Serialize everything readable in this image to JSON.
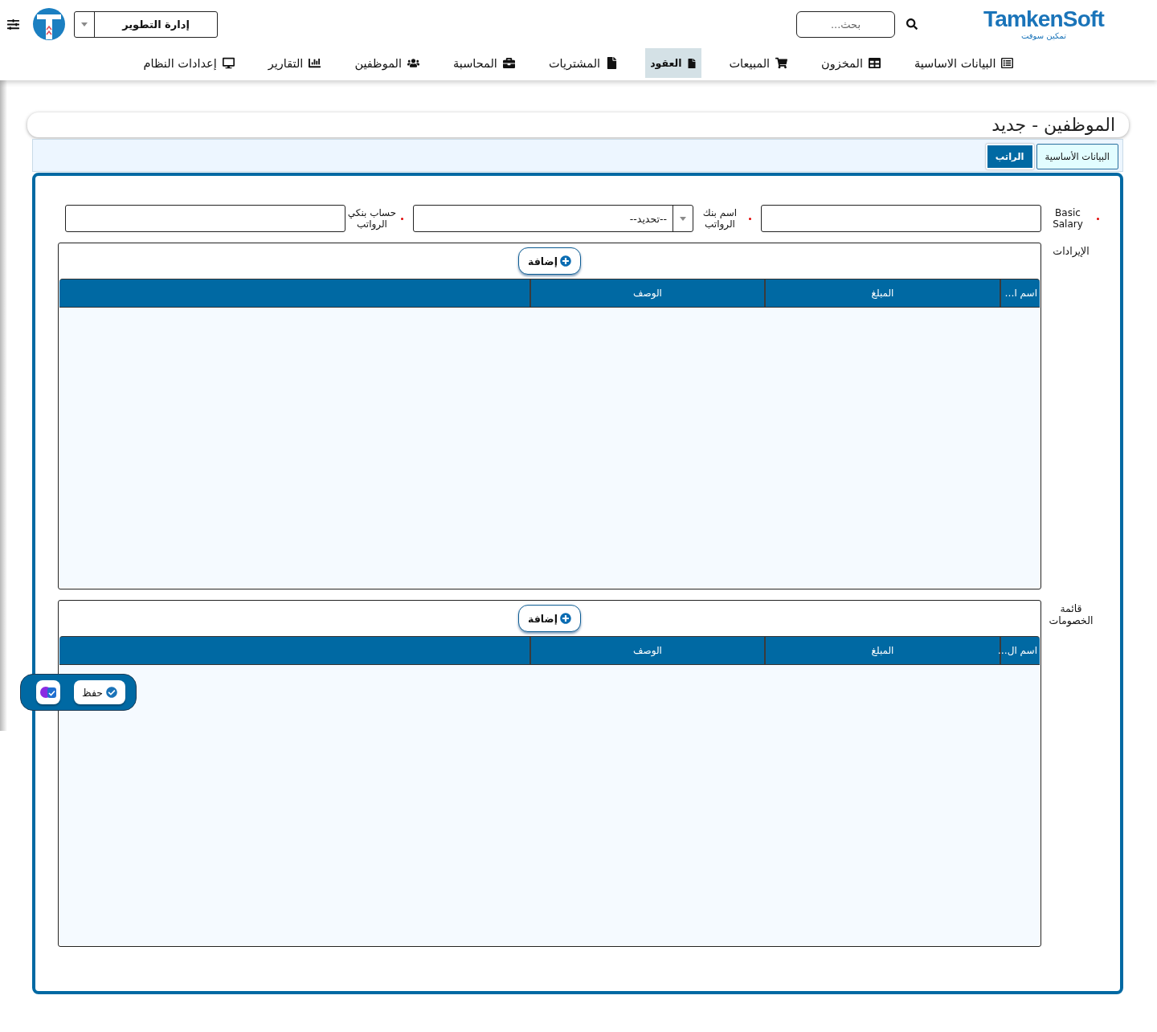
{
  "header": {
    "logo": {
      "wordmark": "TamkenSoft",
      "tagline": "تمكين سوفت"
    },
    "search": {
      "placeholder": "بحث..."
    },
    "department_select": {
      "value": "إدارة التطوير"
    }
  },
  "nav": [
    {
      "label": "البيانات الاساسية",
      "selected": false
    },
    {
      "label": "المخزون",
      "selected": false
    },
    {
      "label": "المبيعات",
      "selected": false
    },
    {
      "label": "العقود",
      "selected": true
    },
    {
      "label": "المشتريات",
      "selected": false
    },
    {
      "label": "المحاسبة",
      "selected": false
    },
    {
      "label": "الموظفين",
      "selected": false
    },
    {
      "label": "التقارير",
      "selected": false
    },
    {
      "label": "إعدادات النظام",
      "selected": false
    }
  ],
  "page_title": "الموظفين - جديد",
  "tabs": [
    {
      "label": "البيانات الأساسية",
      "selected": false
    },
    {
      "label": "الراتب",
      "selected": true
    }
  ],
  "form": {
    "fields": [
      {
        "kind": "input",
        "label": "Basic Salary",
        "required": true
      },
      {
        "kind": "select",
        "label": "اسم بنك الرواتب",
        "required": true,
        "value": "--تحديد--"
      },
      {
        "kind": "input",
        "label": "حساب بنكي الرواتب",
        "required": true
      }
    ]
  },
  "sections": [
    {
      "label": "الإيرادات",
      "add_button": "إضافة",
      "table": {
        "columns": [
          "اسم ا…",
          "المبلغ",
          "الوصف"
        ]
      }
    },
    {
      "label": "قائمة الخصومات",
      "add_button": "إضافة",
      "table": {
        "columns": [
          "اسم ال…",
          "المبلغ",
          "الوصف"
        ]
      }
    }
  ],
  "action_bar": {
    "save_button": "حفظ"
  }
}
